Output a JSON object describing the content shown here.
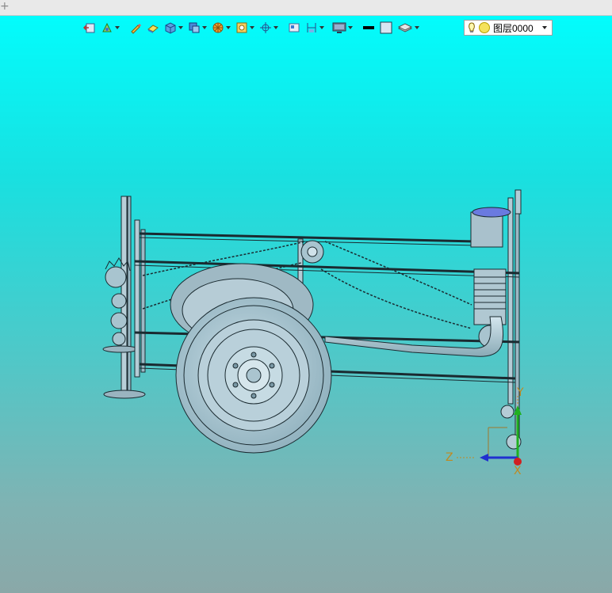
{
  "layer_selector": {
    "value": "图层0000"
  },
  "axes": {
    "y": "Y",
    "z": "Z",
    "x": "X"
  }
}
